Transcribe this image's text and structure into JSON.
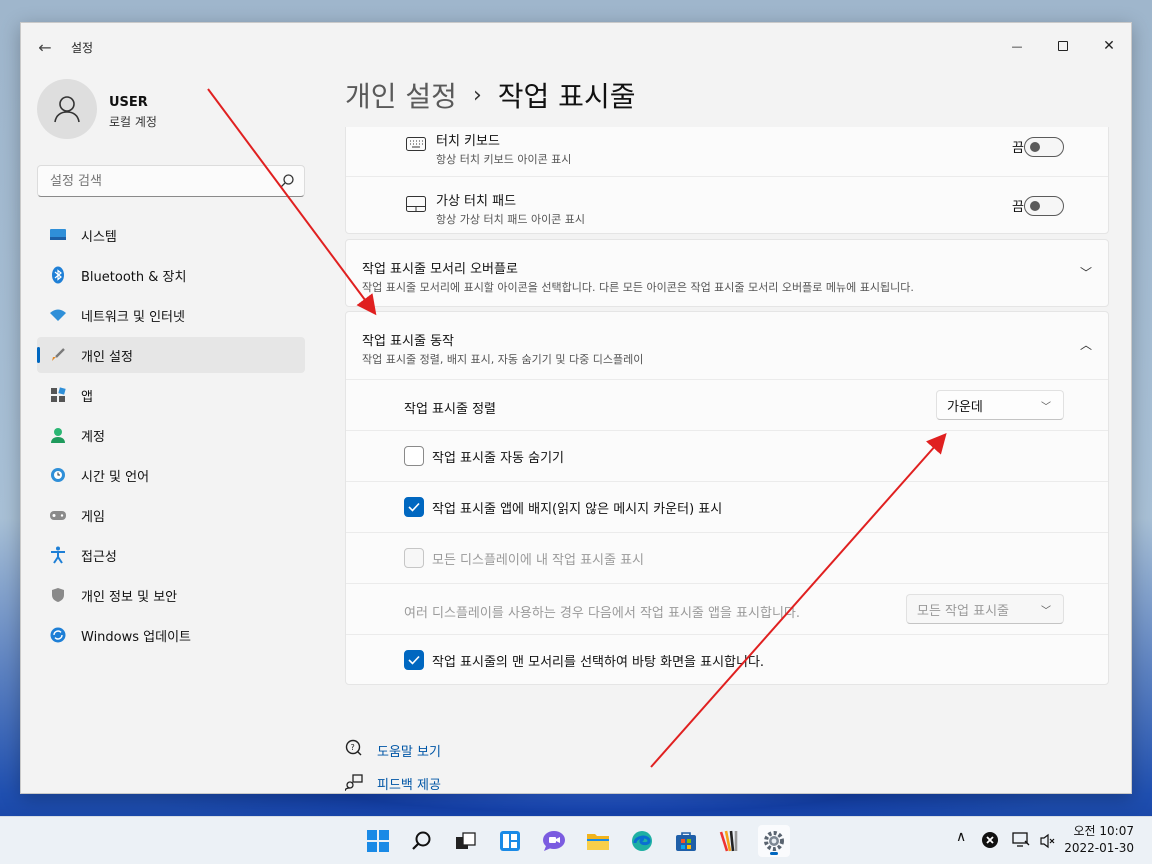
{
  "window": {
    "app_title": "설정",
    "back_glyph": "←",
    "minimize_glyph": "—",
    "close_glyph": "✕"
  },
  "user": {
    "name": "USER",
    "account_type": "로컬 계정"
  },
  "search": {
    "placeholder": "설정 검색"
  },
  "nav": [
    {
      "label": "시스템",
      "icon": "system-icon"
    },
    {
      "label": "Bluetooth & 장치",
      "icon": "bluetooth-icon"
    },
    {
      "label": "네트워크 및 인터넷",
      "icon": "wifi-icon"
    },
    {
      "label": "개인 설정",
      "icon": "brush-icon",
      "active": true
    },
    {
      "label": "앱",
      "icon": "apps-icon"
    },
    {
      "label": "계정",
      "icon": "account-icon"
    },
    {
      "label": "시간 및 언어",
      "icon": "globe-clock-icon"
    },
    {
      "label": "게임",
      "icon": "gamepad-icon"
    },
    {
      "label": "접근성",
      "icon": "accessibility-icon"
    },
    {
      "label": "개인 정보 및 보안",
      "icon": "shield-icon"
    },
    {
      "label": "Windows 업데이트",
      "icon": "update-icon"
    }
  ],
  "breadcrumb": {
    "parent": "개인 설정",
    "separator": "›",
    "current": "작업 표시줄"
  },
  "corner_icons": {
    "touch_keyboard": {
      "title": "터치 키보드",
      "subtitle": "항상 터치 키보드 아이콘 표시",
      "toggle_label": "끔",
      "on": false
    },
    "virtual_touchpad": {
      "title": "가상 터치 패드",
      "subtitle": "항상 가상 터치 패드 아이콘 표시",
      "toggle_label": "끔",
      "on": false
    }
  },
  "overflow": {
    "title": "작업 표시줄 모서리 오버플로",
    "subtitle": "작업 표시줄 모서리에 표시할 아이콘을 선택합니다. 다른 모든 아이콘은 작업 표시줄 모서리 오버플로 메뉴에 표시됩니다.",
    "chevron": "﹀"
  },
  "behaviors": {
    "title": "작업 표시줄 동작",
    "subtitle": "작업 표시줄 정렬, 배지 표시, 자동 숨기기 및 다중 디스플레이",
    "chevron": "︿",
    "alignment": {
      "label": "작업 표시줄 정렬",
      "value": "가운데"
    },
    "auto_hide": {
      "label": "작업 표시줄 자동 숨기기",
      "checked": false
    },
    "badges": {
      "label": "작업 표시줄 앱에 배지(읽지 않은 메시지 카운터) 표시",
      "checked": true
    },
    "all_displays": {
      "label": "모든 디스플레이에 내 작업 표시줄 표시",
      "checked": false,
      "disabled": true
    },
    "multi_display": {
      "label": "여러 디스플레이를 사용하는 경우 다음에서 작업 표시줄 앱을 표시합니다.",
      "value": "모든 작업 표시줄",
      "disabled": true
    },
    "far_corner": {
      "label": "작업 표시줄의 맨 모서리를 선택하여 바탕 화면을 표시합니다.",
      "checked": true
    }
  },
  "links": {
    "help": "도움말 보기",
    "feedback": "피드백 제공"
  },
  "taskbar": {
    "apps": [
      "start-icon",
      "search-icon",
      "task-view-icon",
      "widgets-icon",
      "chat-icon",
      "file-explorer-icon",
      "edge-icon",
      "store-icon",
      "app-icon",
      "settings-icon"
    ],
    "tray_chevron": "∧",
    "clock_ampm_time": "오전 10:07",
    "clock_date": "2022-01-30"
  },
  "colors": {
    "accent": "#0067c0",
    "annotation_arrow": "#e02020"
  }
}
